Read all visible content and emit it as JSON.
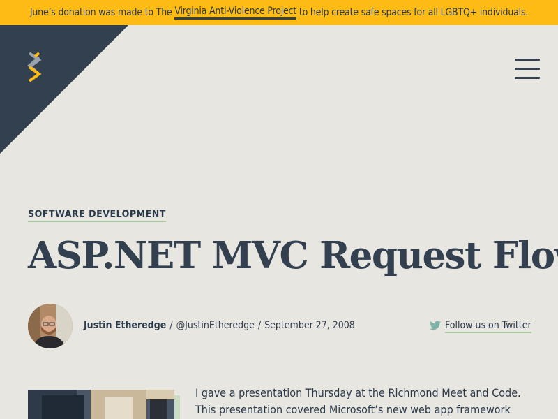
{
  "banner": {
    "prefix": "June’s donation was made to The ",
    "link": "Virginia Anti-Violence Project",
    "suffix": " to help create safe spaces for all LGBTQ+ individuals."
  },
  "colors": {
    "banner": "#fdbb13",
    "navy": "#33404f",
    "background": "#e8e6e1",
    "accent_green": "#a8c8a0"
  },
  "header": {
    "logo_icon": "chevron-mark-icon",
    "menu_icon": "hamburger-menu-icon"
  },
  "article": {
    "category": "SOFTWARE DEVELOPMENT",
    "title": "ASP.NET MVC Request Flow",
    "author": "Justin Etheredge",
    "handle": "@JustinEtheredge",
    "date": "September 27, 2008",
    "separator": "/",
    "follow_label": "Follow us on Twitter",
    "follow_icon": "twitter-icon",
    "intro_line1": "I gave a presentation Thursday at the Richmond Meet and Code.",
    "intro_line2": "This presentation covered Microsoft’s new web app framework"
  }
}
